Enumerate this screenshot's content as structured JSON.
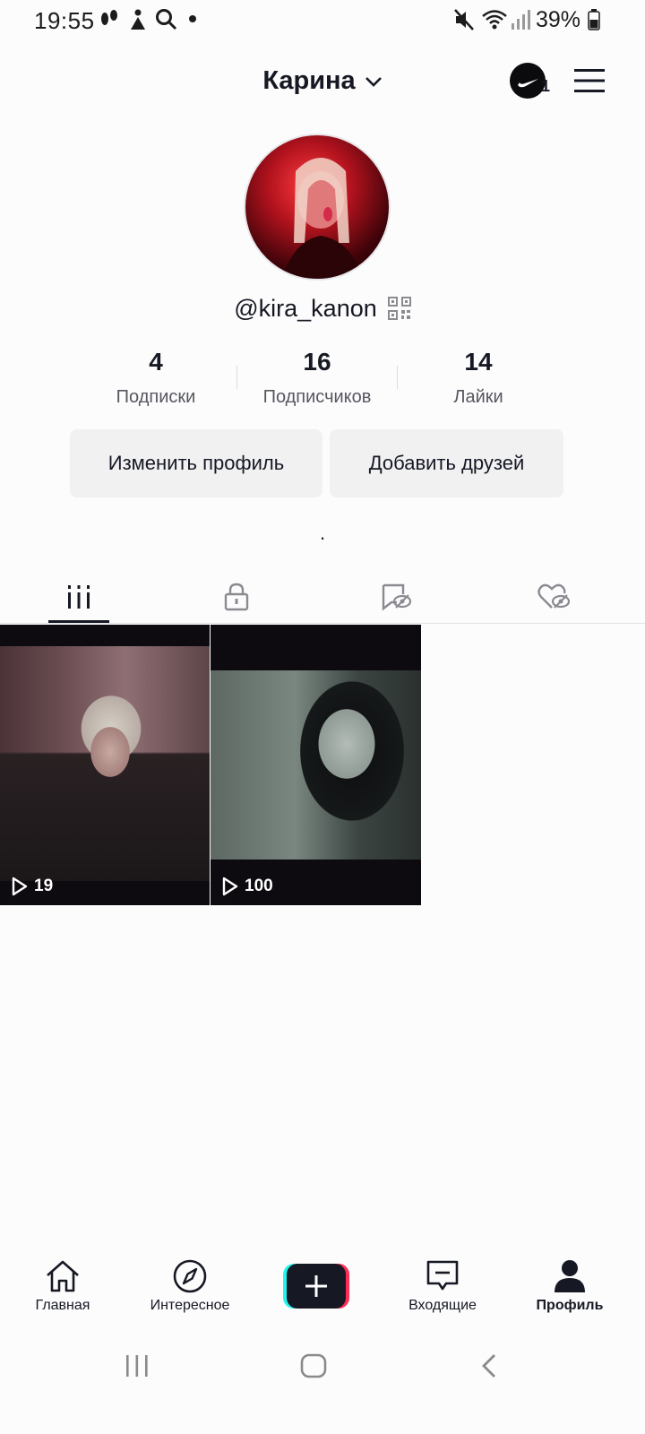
{
  "status_bar": {
    "time": "19:55",
    "battery": "39%",
    "icons": [
      "footsteps-icon",
      "activity-icon",
      "search-icon",
      "dot-icon",
      "mute-icon",
      "wifi-icon",
      "signal-icon",
      "battery-icon"
    ]
  },
  "header": {
    "title": "Карина",
    "account_badge": "1"
  },
  "profile": {
    "username": "@kira_kanon",
    "stats": [
      {
        "value": "4",
        "label": "Подписки"
      },
      {
        "value": "16",
        "label": "Подписчиков"
      },
      {
        "value": "14",
        "label": "Лайки"
      }
    ],
    "edit_button": "Изменить профиль",
    "add_friends_button": "Добавить друзей",
    "bio": "."
  },
  "tabs": [
    "videos-grid-icon",
    "private-lock-icon",
    "reposts-hidden-icon",
    "liked-hidden-icon"
  ],
  "videos": [
    {
      "views": "19"
    },
    {
      "views": "100"
    }
  ],
  "bottom_nav": {
    "home": "Главная",
    "discover": "Интересное",
    "inbox": "Входящие",
    "profile": "Профиль"
  },
  "colors": {
    "text": "#161823",
    "secondary_text": "#56575f",
    "button_bg": "#f1f1f2",
    "create_cyan": "#25f4ee",
    "create_red": "#fe2c55"
  }
}
